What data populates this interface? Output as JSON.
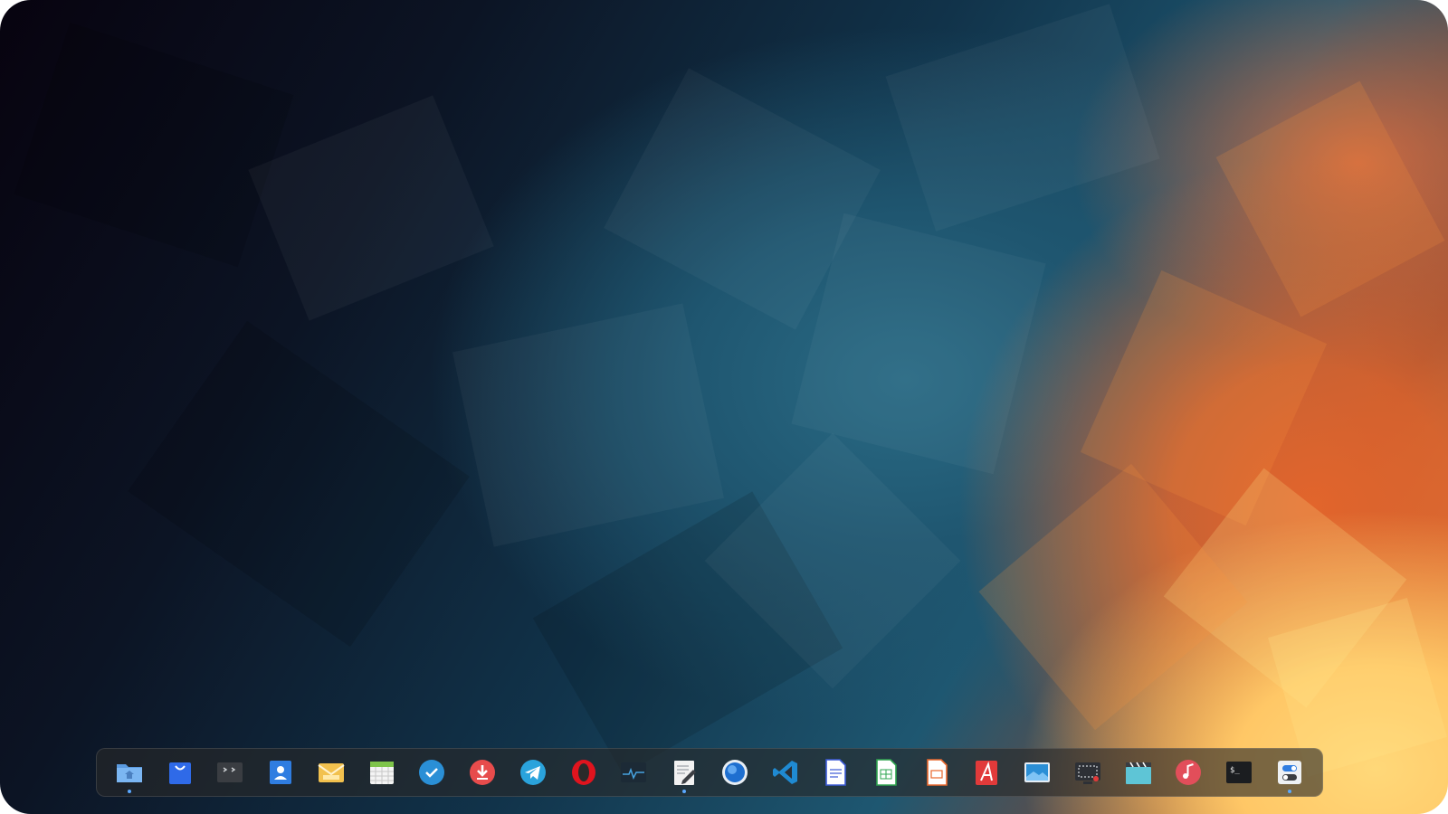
{
  "desktop": {
    "wallpaper": "abstract-shards",
    "colors": {
      "dark": "#07030f",
      "teal": "#1f5670",
      "orange": "#e2652c",
      "yellow": "#ffd879"
    }
  },
  "dock": {
    "items": [
      {
        "icon": "file-manager-icon",
        "running": true
      },
      {
        "icon": "app-store-icon",
        "running": false
      },
      {
        "icon": "multitask-view-icon",
        "running": false
      },
      {
        "icon": "contacts-icon",
        "running": false
      },
      {
        "icon": "mail-icon",
        "running": false
      },
      {
        "icon": "calendar-icon",
        "running": false
      },
      {
        "icon": "tasks-check-icon",
        "running": false
      },
      {
        "icon": "downloader-icon",
        "running": false
      },
      {
        "icon": "telegram-icon",
        "running": false
      },
      {
        "icon": "opera-browser-icon",
        "running": false
      },
      {
        "icon": "system-monitor-icon",
        "running": false
      },
      {
        "icon": "text-editor-icon",
        "running": true
      },
      {
        "icon": "web-browser-icon",
        "running": false
      },
      {
        "icon": "vscode-icon",
        "running": false
      },
      {
        "icon": "document-writer-icon",
        "running": false
      },
      {
        "icon": "spreadsheet-icon",
        "running": false
      },
      {
        "icon": "presentation-icon",
        "running": false
      },
      {
        "icon": "pdf-reader-icon",
        "running": false
      },
      {
        "icon": "image-viewer-icon",
        "running": false
      },
      {
        "icon": "screen-recorder-icon",
        "running": false
      },
      {
        "icon": "movie-player-icon",
        "running": false
      },
      {
        "icon": "music-player-icon",
        "running": false
      },
      {
        "icon": "terminal-icon",
        "running": false
      },
      {
        "icon": "control-center-icon",
        "running": true
      }
    ]
  }
}
